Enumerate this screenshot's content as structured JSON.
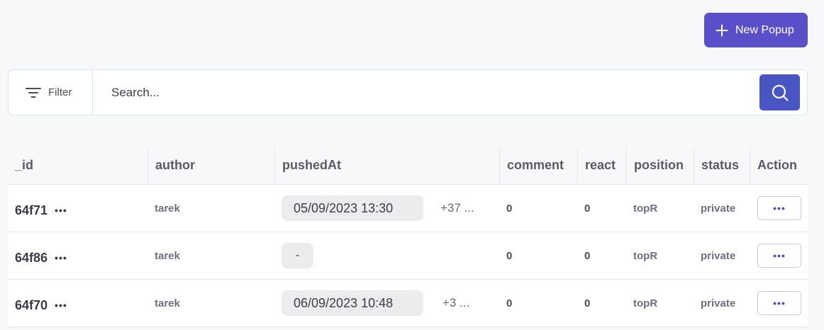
{
  "header": {
    "new_button_label": "New Popup"
  },
  "search": {
    "filter_label": "Filter",
    "placeholder": "Search..."
  },
  "table": {
    "columns": [
      "_id",
      "author",
      "pushedAt",
      "comment",
      "react",
      "position",
      "status",
      "Action"
    ],
    "rows": [
      {
        "id": "64f71",
        "author": "tarek",
        "pushedAt": "05/09/2023 13:30",
        "more": "+37 ...",
        "comment": "0",
        "react": "0",
        "position": "topR",
        "status": "private",
        "action": "•••"
      },
      {
        "id": "64f86",
        "author": "tarek",
        "pushedAt": "-",
        "more": "",
        "comment": "0",
        "react": "0",
        "position": "topR",
        "status": "private",
        "action": "•••"
      },
      {
        "id": "64f70",
        "author": "tarek",
        "pushedAt": "06/09/2023 10:48",
        "more": "+3 ...",
        "comment": "0",
        "react": "0",
        "position": "topR",
        "status": "private",
        "action": "•••"
      }
    ],
    "row_menu": "•••"
  },
  "colors": {
    "primary": "#5b4fc9",
    "search_button": "#4a55c4",
    "border": "#d6e7f3"
  },
  "icons": {
    "new": "plus-icon",
    "filter": "filter-lines-icon",
    "search": "search-icon",
    "row_menu": "more-dots-icon",
    "action": "more-dots-icon"
  }
}
